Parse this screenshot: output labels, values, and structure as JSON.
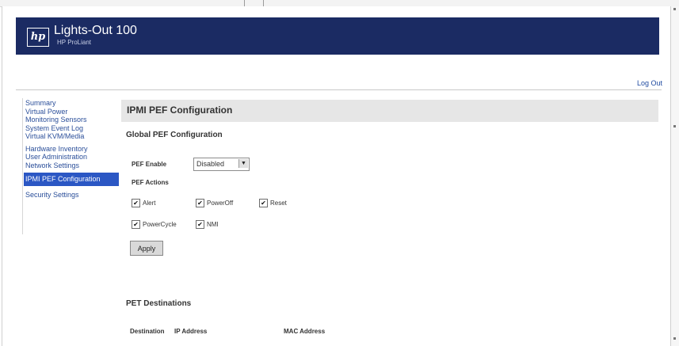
{
  "header": {
    "logo_glyph": "hp",
    "product_name": "Lights-Out 100",
    "product_subtitle": "HP ProLiant",
    "logout_label": "Log Out",
    "banner_color": "#1b2b63"
  },
  "sidebar": {
    "items": [
      {
        "label": "Summary"
      },
      {
        "label": "Virtual Power"
      },
      {
        "label": "Monitoring Sensors"
      },
      {
        "label": "System Event Log"
      },
      {
        "label": "Virtual KVM/Media"
      },
      {
        "label": "Hardware Inventory"
      },
      {
        "label": "User Administration"
      },
      {
        "label": "Network Settings"
      },
      {
        "label": "IPMI PEF Configuration",
        "active": true
      },
      {
        "label": "Security Settings"
      }
    ],
    "active_color": "#2b57c4"
  },
  "content": {
    "title": "IPMI PEF Configuration",
    "global_section_title": "Global PEF Configuration",
    "pef_enable_label": "PEF Enable",
    "pef_enable_value": "Disabled",
    "pef_actions_label": "PEF Actions",
    "actions": [
      {
        "label": "Alert",
        "checked": true
      },
      {
        "label": "PowerOff",
        "checked": true
      },
      {
        "label": "Reset",
        "checked": true
      },
      {
        "label": "PowerCycle",
        "checked": true
      },
      {
        "label": "NMI",
        "checked": true
      }
    ],
    "check_glyph": "✔",
    "apply_label": "Apply",
    "pet_title": "PET Destinations",
    "pet_columns": [
      "Destination",
      "IP Address",
      "MAC Address"
    ]
  }
}
